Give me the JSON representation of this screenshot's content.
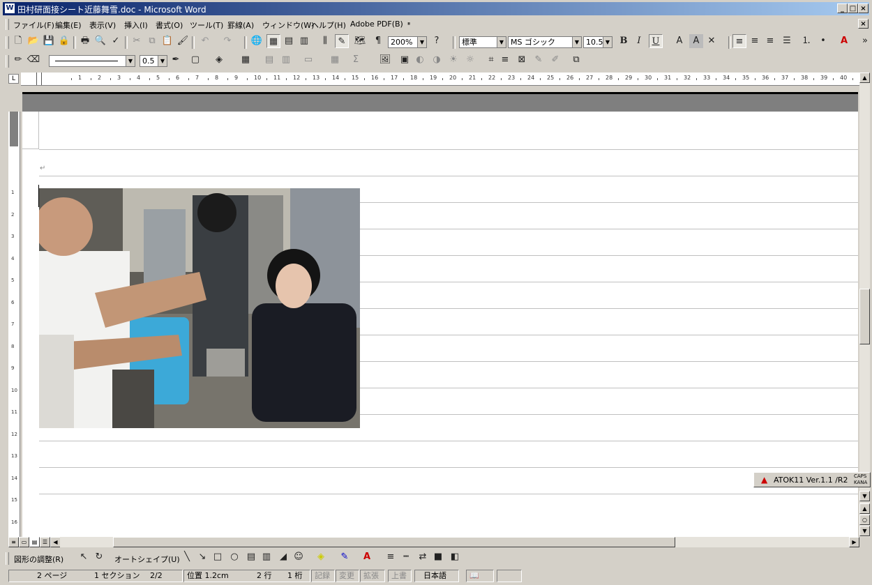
{
  "window": {
    "title": "田村研面接シート近藤舞雪.doc - Microsoft Word",
    "icon": "word-doc-icon",
    "min": "_",
    "max": "□",
    "close": "×"
  },
  "menu": {
    "items": [
      "ファイル(F)",
      "編集(E)",
      "表示(V)",
      "挿入(I)",
      "書式(O)",
      "ツール(T)",
      "罫線(A)",
      "ウィンドウ(W)",
      "ヘルプ(H)",
      "Adobe PDF(B)",
      "ײ"
    ],
    "close": "×"
  },
  "toolbar_standard": {
    "zoom": "200%"
  },
  "toolbar_format": {
    "style": "標準",
    "font": "MS ゴシック",
    "size": "10.5",
    "bold": "B",
    "italic": "I",
    "underline": "U"
  },
  "toolbar_draw_top": {
    "line_width": "0.5"
  },
  "ruler": {
    "numbers": [
      "1",
      "2",
      "3",
      "4",
      "5",
      "6",
      "7",
      "8",
      "9",
      "10",
      "11",
      "12",
      "13",
      "14",
      "15",
      "16",
      "17",
      "18",
      "19",
      "20",
      "21",
      "22",
      "23",
      "24",
      "25",
      "26",
      "27",
      "28",
      "29",
      "30",
      "31",
      "32",
      "33",
      "34",
      "35",
      "36",
      "37",
      "38",
      "39",
      "40",
      "41"
    ]
  },
  "document": {
    "paragraph_mark": "↵",
    "photo_alt": "photo"
  },
  "draw_toolbar": {
    "adjust": "図形の調整(R)",
    "autoshape": "オートシェイプ(U)"
  },
  "atok": {
    "label": "ATOK11 Ver.1.1 /R2",
    "caps": "CAPS",
    "kana": "KANA"
  },
  "status": {
    "page": "2 ページ",
    "section": "1 セクション",
    "pages": "2/2",
    "position": "位置 1.2cm",
    "line": "2 行",
    "column": "1 桁",
    "rec": "記録",
    "trk": "変更",
    "ext": "拡張",
    "ovr": "上書",
    "lang": "日本語"
  }
}
